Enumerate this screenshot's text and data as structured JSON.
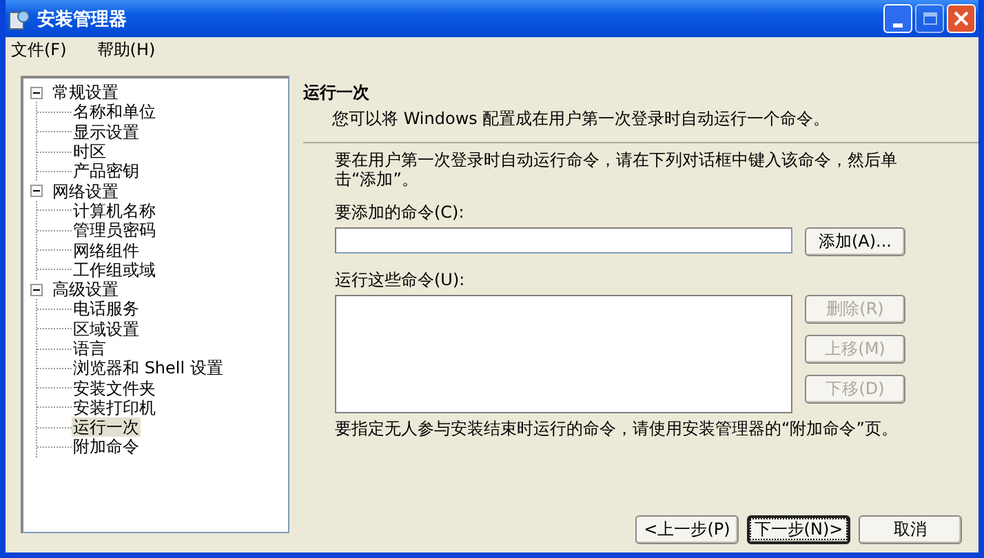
{
  "window": {
    "title": "安装管理器"
  },
  "menu": [
    "文件(F)",
    "帮助(H)"
  ],
  "tree": [
    {
      "label": "常规设置",
      "expanded": true,
      "children": [
        {
          "label": "名称和单位",
          "selected": false
        },
        {
          "label": "显示设置",
          "selected": false
        },
        {
          "label": "时区",
          "selected": false
        },
        {
          "label": "产品密钥",
          "selected": false
        }
      ]
    },
    {
      "label": "网络设置",
      "expanded": true,
      "children": [
        {
          "label": "计算机名称",
          "selected": false
        },
        {
          "label": "管理员密码",
          "selected": false
        },
        {
          "label": "网络组件",
          "selected": false
        },
        {
          "label": "工作组或域",
          "selected": false
        }
      ]
    },
    {
      "label": "高级设置",
      "expanded": true,
      "children": [
        {
          "label": "电话服务",
          "selected": false
        },
        {
          "label": "区域设置",
          "selected": false
        },
        {
          "label": "语言",
          "selected": false
        },
        {
          "label": "浏览器和 Shell 设置",
          "selected": false
        },
        {
          "label": "安装文件夹",
          "selected": false
        },
        {
          "label": "安装打印机",
          "selected": false
        },
        {
          "label": "运行一次",
          "selected": true
        },
        {
          "label": "附加命令",
          "selected": false
        }
      ]
    }
  ],
  "page": {
    "title": "运行一次",
    "subtitle": "您可以将 Windows 配置成在用户第一次登录时自动运行一个命令。",
    "intro": "要在用户第一次登录时自动运行命令，请在下列对话框中键入该命令，然后单击“添加”。",
    "command_label": "要添加的命令(C):",
    "add_button": "添加(A)...",
    "list_label": "运行这些命令(U):",
    "list_buttons": [
      {
        "label": "删除(R)",
        "disabled": true
      },
      {
        "label": "上移(M)",
        "disabled": true
      },
      {
        "label": "下移(D)",
        "disabled": true
      }
    ],
    "note": "要指定无人参与安装结束时运行的命令，请使用安装管理器的“附加命令”页。"
  },
  "buttons": [
    {
      "label": "<上一步(P)",
      "default": false
    },
    {
      "label": "下一步(N)>",
      "default": true
    },
    {
      "label": "取消",
      "default": false
    }
  ]
}
